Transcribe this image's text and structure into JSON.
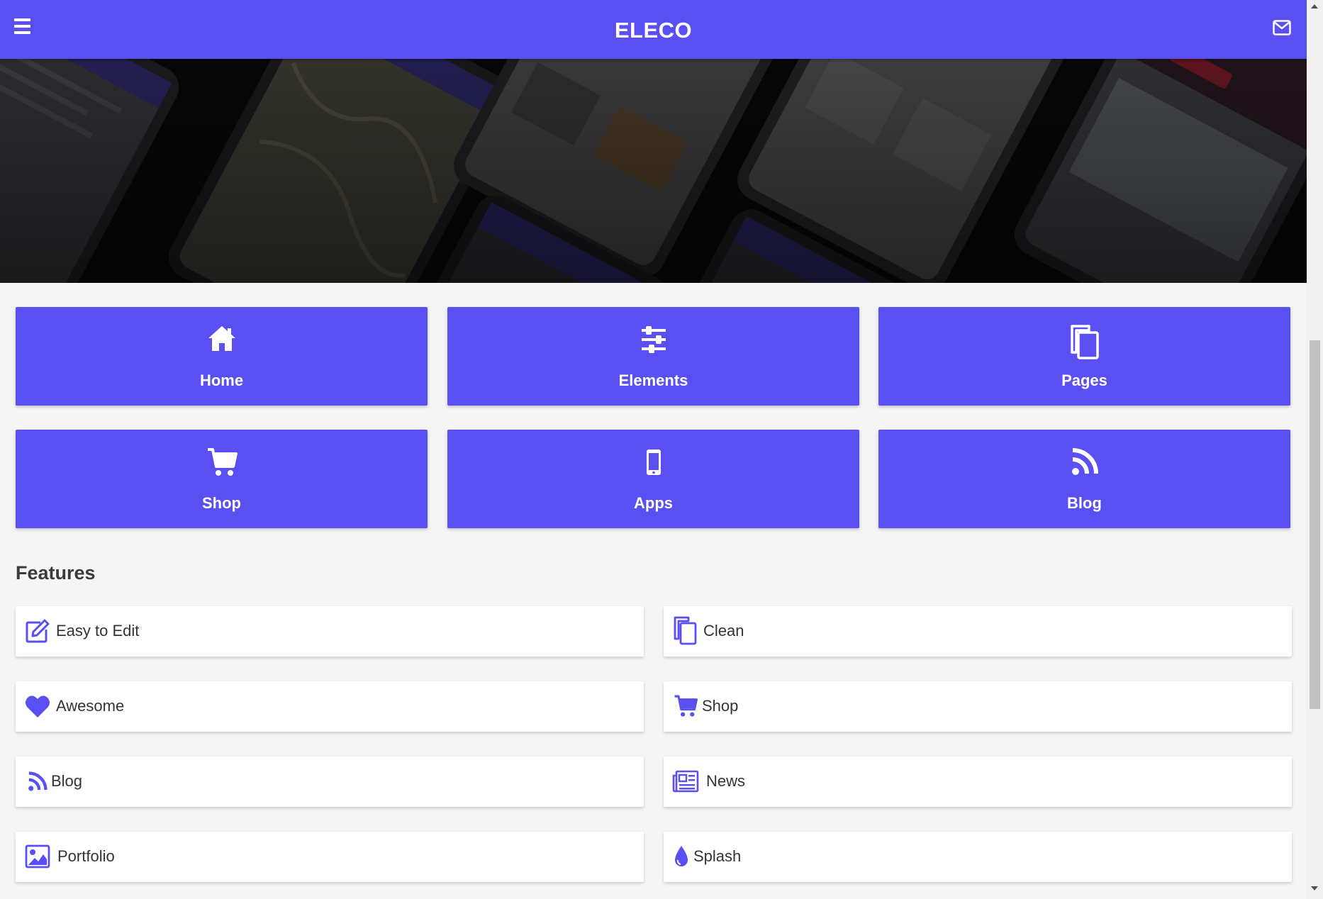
{
  "header": {
    "title": "ELECO",
    "menu_icon": "hamburger-menu-icon",
    "mail_icon": "envelope-icon"
  },
  "colors": {
    "accent": "#5a4ff1",
    "background": "#f5f5f5",
    "card": "#ffffff",
    "text": "#333333"
  },
  "tiles": [
    {
      "label": "Home",
      "icon": "home-icon"
    },
    {
      "label": "Elements",
      "icon": "sliders-icon"
    },
    {
      "label": "Pages",
      "icon": "copy-pages-icon"
    },
    {
      "label": "Shop",
      "icon": "cart-icon"
    },
    {
      "label": "Apps",
      "icon": "mobile-phone-icon"
    },
    {
      "label": "Blog",
      "icon": "rss-icon"
    }
  ],
  "features": {
    "title": "Features",
    "items": [
      {
        "label": "Easy to Edit",
        "icon": "edit-icon"
      },
      {
        "label": "Clean",
        "icon": "copy-pages-icon"
      },
      {
        "label": "Awesome",
        "icon": "heart-icon"
      },
      {
        "label": "Shop",
        "icon": "cart-icon"
      },
      {
        "label": "Blog",
        "icon": "rss-icon"
      },
      {
        "label": "News",
        "icon": "newspaper-icon"
      },
      {
        "label": "Portfolio",
        "icon": "image-icon"
      },
      {
        "label": "Splash",
        "icon": "droplet-icon"
      }
    ]
  }
}
